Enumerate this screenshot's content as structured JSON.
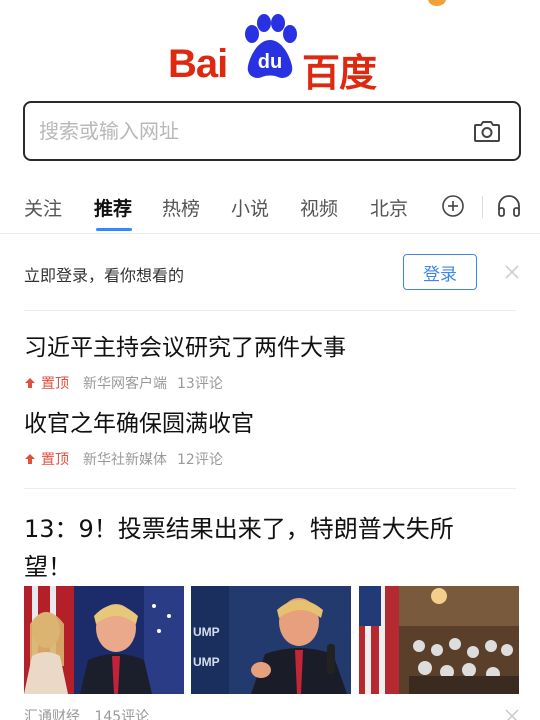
{
  "logo": {
    "bai": "Bai",
    "du": "du",
    "baidu_cn": "百度"
  },
  "search": {
    "placeholder": "搜索或输入网址"
  },
  "tabs": [
    {
      "label": "关注"
    },
    {
      "label": "推荐"
    },
    {
      "label": "热榜"
    },
    {
      "label": "小说"
    },
    {
      "label": "视频"
    },
    {
      "label": "北京"
    }
  ],
  "login_prompt": {
    "text": "立即登录，看你想看的",
    "button": "登录"
  },
  "news": [
    {
      "title": "习近平主持会议研究了两件大事",
      "badge": "置顶",
      "source": "新华网客户端",
      "comments": "13评论"
    },
    {
      "title": "收官之年确保圆满收官",
      "badge": "置顶",
      "source": "新华社新媒体",
      "comments": "12评论"
    }
  ],
  "feature": {
    "title": "13：9！投票结果出来了，特朗普大失所望！",
    "source": "汇通财经",
    "comments": "145评论"
  },
  "colors": {
    "brand_red": "#de2910",
    "brand_blue": "#2932e1",
    "accent_blue": "#3388ff",
    "pin_red": "#e0503f"
  }
}
